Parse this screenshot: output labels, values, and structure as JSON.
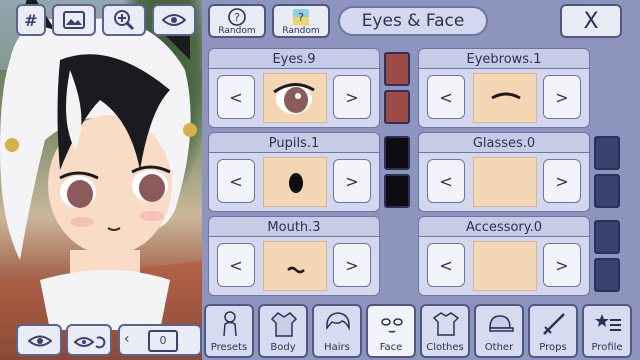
{
  "toolbar_left": {
    "hash": "#",
    "image_icon": "image-icon",
    "zoom_icon": "zoom-in-icon",
    "eye_icon": "eye-icon"
  },
  "bottom_left": {
    "eye_icon": "eye-icon",
    "rotate_icon": "rotate-eye-icon",
    "slot": "0"
  },
  "header": {
    "random_label": "Random",
    "random2_label": "Random",
    "title": "Eyes & Face",
    "close": "X"
  },
  "cards": [
    {
      "label": "Eyes.9",
      "left": "<",
      "right": ">",
      "swatches": [
        "#9b4a46",
        "#9b4a46"
      ]
    },
    {
      "label": "Eyebrows.1",
      "left": "<",
      "right": ">",
      "swatches": []
    },
    {
      "label": "Pupils.1",
      "left": "<",
      "right": ">",
      "swatches": [
        "#0d0d12",
        "#0d0d12"
      ]
    },
    {
      "label": "Glasses.0",
      "left": "<",
      "right": ">",
      "swatches": [
        "#3c4270",
        "#3c4270"
      ]
    },
    {
      "label": "Mouth.3",
      "left": "<",
      "right": ">",
      "swatches": []
    },
    {
      "label": "Accessory.0",
      "left": "<",
      "right": ">",
      "swatches": [
        "#3c4270",
        "#3c4270"
      ]
    }
  ],
  "tabs": [
    {
      "label": "Presets",
      "icon": "person-outline-icon"
    },
    {
      "label": "Body",
      "icon": "jacket-icon"
    },
    {
      "label": "Hairs",
      "icon": "hair-icon"
    },
    {
      "label": "Face",
      "icon": "face-icon"
    },
    {
      "label": "Clothes",
      "icon": "shirt-icon"
    },
    {
      "label": "Other",
      "icon": "cap-icon"
    },
    {
      "label": "Props",
      "icon": "sword-icon"
    },
    {
      "label": "Profile",
      "icon": "star-list-icon"
    }
  ],
  "colors": {
    "panel": "#8d94bd",
    "card_bg": "#d4d8ee",
    "skin": "#f5d6b4"
  }
}
